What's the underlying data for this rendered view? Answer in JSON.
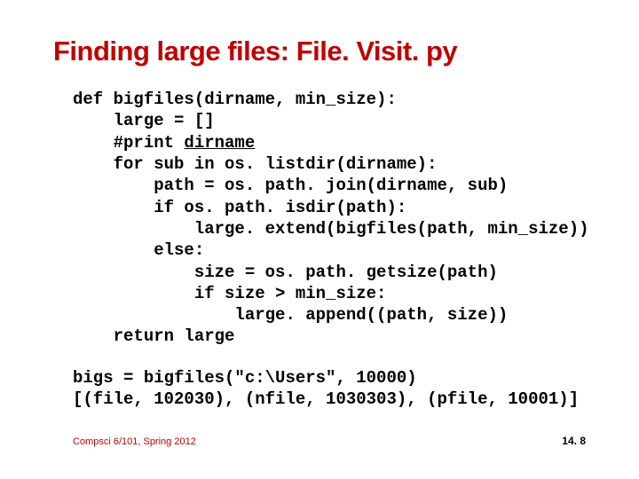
{
  "title": "Finding large files: File. Visit. py",
  "code": {
    "l1": "def bigfiles(dirname, min_size):",
    "l2": "    large = []",
    "l3a": "    #print ",
    "l3b": "dirname",
    "l4": "    for sub in os. listdir(dirname):",
    "l5": "        path = os. path. join(dirname, sub)",
    "l6": "        if os. path. isdir(path):",
    "l7": "            large. extend(bigfiles(path, min_size))",
    "l8": "        else:",
    "l9": "            size = os. path. getsize(path)",
    "l10": "            if size > min_size:",
    "l11": "                large. append((path, size))",
    "l12": "    return large"
  },
  "output": {
    "o1": "bigs = bigfiles(\"c:\\Users\", 10000)",
    "o2": "[(file, 102030), (nfile, 1030303), (pfile, 10001)]"
  },
  "footer": {
    "left": "Compsci 6/101, Spring 2012",
    "right": "14. 8"
  }
}
